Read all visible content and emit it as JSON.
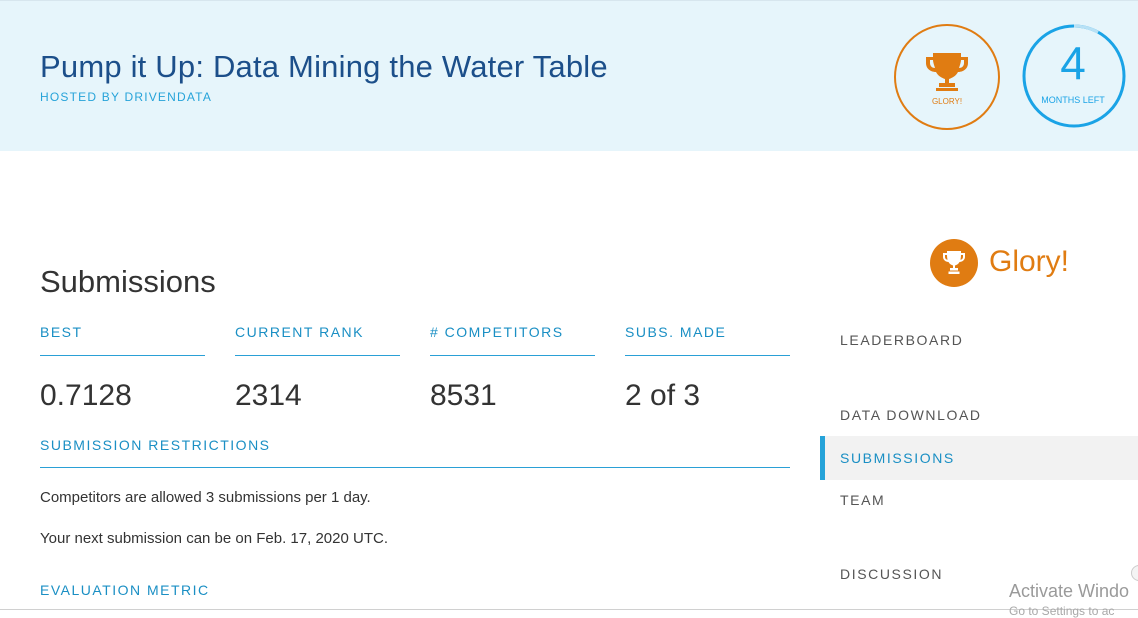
{
  "hero": {
    "title": "Pump it Up: Data Mining the Water Table",
    "host": "HOSTED BY DRIVENDATA",
    "prize_label": "GLORY!",
    "time_number": "4",
    "time_label": "MONTHS LEFT",
    "time_fraction_elapsed": 0.08
  },
  "submissions": {
    "title": "Submissions",
    "stats": [
      {
        "label": "BEST",
        "value": "0.7128"
      },
      {
        "label": "CURRENT RANK",
        "value": "2314"
      },
      {
        "label": "# COMPETITORS",
        "value": "8531"
      },
      {
        "label": "SUBS. MADE",
        "value": "2 of 3"
      }
    ],
    "restrictions_heading": "SUBMISSION RESTRICTIONS",
    "restriction_text": "Competitors are allowed 3 submissions per 1 day.",
    "next_submission_text": "Your next submission can be on Feb. 17, 2020 UTC.",
    "evaluation_heading": "EVALUATION METRIC"
  },
  "sidebar": {
    "prize": "Glory!",
    "items": [
      {
        "label": "LEADERBOARD",
        "active": false
      },
      {
        "label": "DATA DOWNLOAD",
        "active": false
      },
      {
        "label": "SUBMISSIONS",
        "active": true
      },
      {
        "label": "TEAM",
        "active": false
      },
      {
        "label": "DISCUSSION",
        "active": false
      }
    ]
  },
  "watermark": {
    "line1": "Activate Windo",
    "line2": "Go to Settings to ac"
  },
  "colors": {
    "accent": "#26a3d9",
    "prize": "#e07c12",
    "hero_bg": "#e6f5fb"
  }
}
